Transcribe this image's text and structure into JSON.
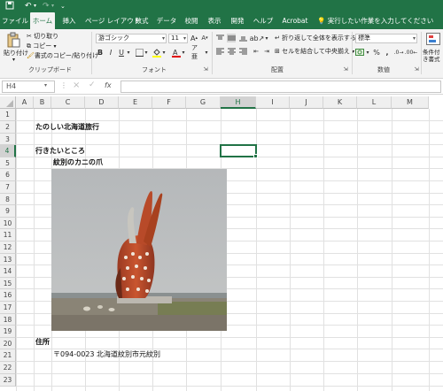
{
  "tabs": [
    "ファイル",
    "ホーム",
    "挿入",
    "ページ レイアウト",
    "数式",
    "データ",
    "校閲",
    "表示",
    "開発",
    "ヘルプ",
    "Acrobat"
  ],
  "tell_me": "実行したい作業を入力してください",
  "clipboard": {
    "paste_label": "貼り付け",
    "cut_label": "切り取り",
    "copy_label": "コピー",
    "format_painter_label": "書式のコピー/貼り付け",
    "group_label": "クリップボード"
  },
  "font": {
    "name": "游ゴシック",
    "size": "11",
    "group_label": "フォント"
  },
  "alignment": {
    "wrap_label": "折り返して全体を表示する",
    "merge_label": "セルを結合して中央揃え",
    "group_label": "配置"
  },
  "number": {
    "format": "標準",
    "group_label": "数値"
  },
  "styles": {
    "conditional_label": "条件付き書式"
  },
  "formula_bar": {
    "name_box": "H4",
    "fx": "fx"
  },
  "columns": [
    "A",
    "B",
    "C",
    "D",
    "E",
    "F",
    "G",
    "H",
    "I",
    "J",
    "K",
    "L",
    "M"
  ],
  "rows": [
    "1",
    "2",
    "3",
    "4",
    "5",
    "6",
    "7",
    "8",
    "9",
    "10",
    "11",
    "12",
    "13",
    "14",
    "15",
    "16",
    "17",
    "18",
    "19",
    "20",
    "21",
    "22",
    "23"
  ],
  "cells": {
    "b2": "たのしい北海道旅行",
    "b4": "行きたいところ",
    "c5": "紋別のカニの爪",
    "b20": "住所",
    "c21": "〒094-0023 北海道紋別市元紋別"
  },
  "colors": {
    "excel_green": "#217346",
    "ribbon_bg": "#f3f3f3",
    "gridline": "#e1e1e1"
  }
}
